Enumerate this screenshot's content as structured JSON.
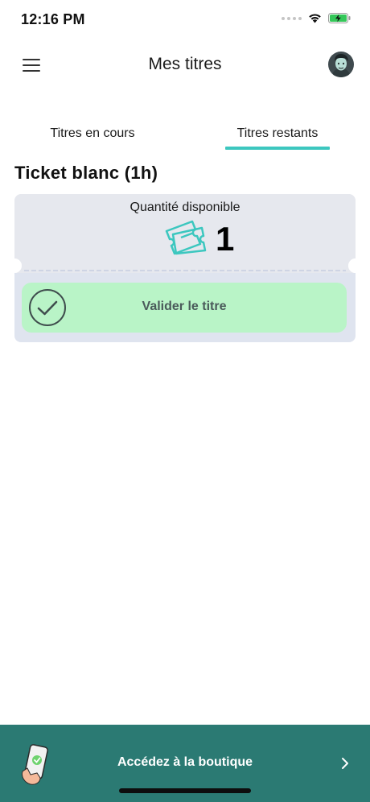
{
  "status_bar": {
    "time": "12:16 PM"
  },
  "header": {
    "title": "Mes titres",
    "menu_icon": "hamburger-menu-icon",
    "avatar_icon": "user-avatar"
  },
  "tabs": {
    "items": [
      {
        "label": "Titres en cours",
        "active": false
      },
      {
        "label": "Titres restants",
        "active": true
      }
    ],
    "accent_color": "#3cc7bf"
  },
  "ticket": {
    "title": "Ticket blanc (1h)",
    "quantity_label": "Quantité disponible",
    "quantity_value": "1",
    "ticket_icon": "ticket-icon",
    "validate_label": "Valider le titre",
    "validate_icon": "check-circle-icon",
    "validate_color": "#b9f4c7"
  },
  "shop": {
    "label": "Accédez à la boutique",
    "icon": "phone-in-hand-icon",
    "chevron_icon": "chevron-right-icon",
    "background_color": "#2b7a73"
  }
}
